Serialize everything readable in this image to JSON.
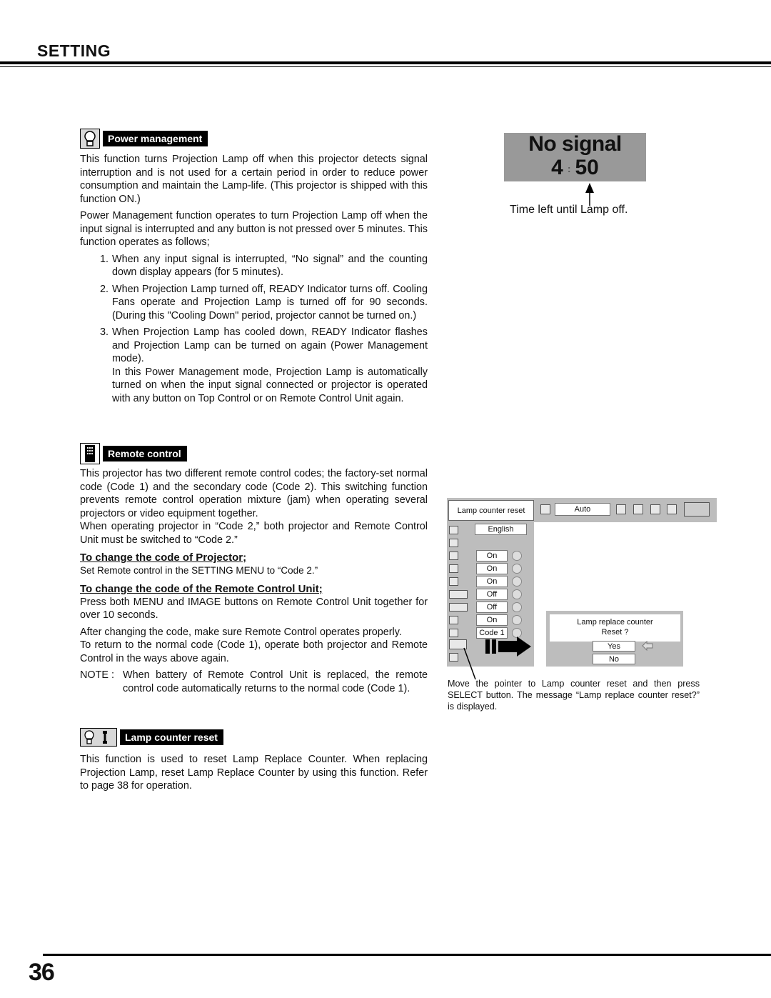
{
  "header": {
    "title": "SETTING"
  },
  "power_management": {
    "label": "Power management",
    "icon": "lamp-icon",
    "para1": "This function turns Projection Lamp off when this projector detects signal interruption and is not used for a certain period in order to reduce power consumption and maintain the Lamp-life.  (This projector is shipped with this function ON.)",
    "para2": "Power Management function operates to turn Projection Lamp off when the input signal is interrupted and any button is not pressed over 5 minutes.  This function operates as follows;",
    "steps": [
      {
        "num": "1.",
        "text": "When any input signal is interrupted, “No signal” and the counting down display appears (for 5 minutes)."
      },
      {
        "num": "2.",
        "text": "When Projection Lamp turned off, READY Indicator turns off.  Cooling Fans operate and Projection Lamp is turned off for 90 seconds.  (During this \"Cooling Down\" period, projector cannot be turned on.)"
      },
      {
        "num": "3.",
        "text": "When Projection Lamp has cooled down, READY Indicator flashes and Projection Lamp can be turned on again (Power Management mode)."
      }
    ],
    "step3_extra": "In this Power Management mode, Projection Lamp is automatically turned on when the input signal connected or projector is operated with any button on Top Control or on Remote Control Unit again."
  },
  "osd": {
    "line1": "No signal",
    "minutes": "4",
    "colon": ":",
    "seconds": "50",
    "caption": "Time left until Lamp off."
  },
  "remote_control": {
    "label": "Remote control",
    "icon": "remote-icon",
    "para1": "This projector has two different remote control codes; the factory-set normal code (Code 1) and the secondary code (Code 2).  This switching function prevents remote control operation mixture (jam) when operating several projectors or video equipment together.",
    "para2": "When operating projector in “Code 2,”  both projector and Remote Control Unit must be switched to “Code 2.”",
    "sub1_title": "To change the code of Projector;",
    "sub1_text": "Set Remote control in the SETTING MENU to “Code 2.”",
    "sub2_title": "To change the code of the Remote Control Unit;",
    "sub2_text": "Press both MENU and IMAGE buttons on Remote Control Unit together for over 10 seconds.",
    "para3": "After changing the code, make sure Remote Control operates properly.",
    "para4": "To return to the normal code (Code 1), operate both projector and Remote Control in the ways above again.",
    "note_label": "NOTE :",
    "note_text": "When battery of Remote Control Unit is replaced, the remote control code automatically returns to the normal code (Code 1)."
  },
  "lamp_counter_reset": {
    "label": "Lamp counter reset",
    "icon": "lamp-counter-icon",
    "para1": "This function is used to reset Lamp Replace Counter.  When replacing Projection Lamp, reset Lamp Replace Counter by using this function.  Refer to page 38 for operation."
  },
  "menu_screenshot": {
    "title": "Lamp counter reset",
    "source_value": "Auto",
    "language": "English",
    "rows": [
      "On",
      "On",
      "On",
      "Off",
      "Off",
      "On",
      "Code 1"
    ],
    "dialog_line1": "Lamp replace counter",
    "dialog_line2": "Reset ?",
    "yes": "Yes",
    "no": "No",
    "caption": "Move the pointer to Lamp counter reset and then press SELECT button.  The message “Lamp replace counter reset?” is displayed."
  },
  "footer": {
    "page_number": "36"
  }
}
